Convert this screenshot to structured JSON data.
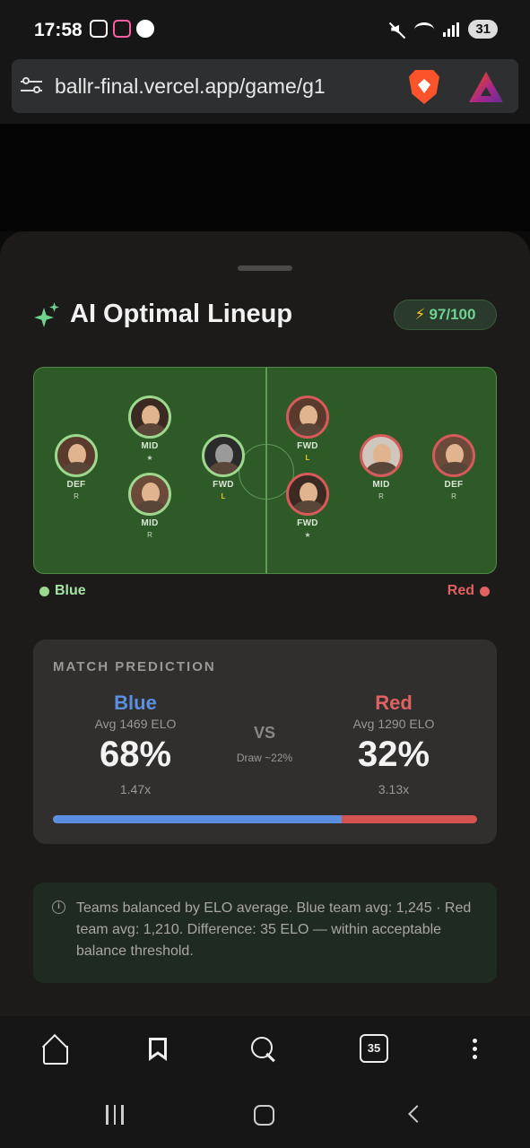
{
  "status_bar": {
    "time": "17:58",
    "battery": "31"
  },
  "browser": {
    "url": "ballr-final.vercel.app/game/g1",
    "tabs_count": "35"
  },
  "sheet": {
    "title": "AI Optimal Lineup",
    "score": "97/100"
  },
  "pitch": {
    "blue_players": [
      {
        "position": "DEF",
        "side": "R"
      },
      {
        "position": "MID",
        "side": "★"
      },
      {
        "position": "MID",
        "side": "R"
      },
      {
        "position": "FWD",
        "side": "L"
      }
    ],
    "red_players": [
      {
        "position": "FWD",
        "side": "L"
      },
      {
        "position": "FWD",
        "side": "★"
      },
      {
        "position": "MID",
        "side": "R"
      },
      {
        "position": "DEF",
        "side": "R"
      }
    ],
    "legend_blue": "Blue",
    "legend_red": "Red"
  },
  "prediction": {
    "heading": "MATCH PREDICTION",
    "blue": {
      "name": "Blue",
      "avg_elo": "Avg 1469 ELO",
      "win_pct": "68%",
      "odds": "1.47x",
      "win_fraction": 0.68
    },
    "red": {
      "name": "Red",
      "avg_elo": "Avg 1290 ELO",
      "win_pct": "32%",
      "odds": "3.13x"
    },
    "vs": "VS",
    "draw": "Draw ~22%"
  },
  "info_note": {
    "text": "Teams balanced by ELO average. Blue team avg: 1,245 · Red team avg: 1,210. Difference: 35 ELO — within acceptable balance threshold."
  },
  "colors": {
    "accent_green": "#6fd38f",
    "blue": "#5d8fe0",
    "red": "#e06161",
    "pitch": "#2e5a28"
  }
}
